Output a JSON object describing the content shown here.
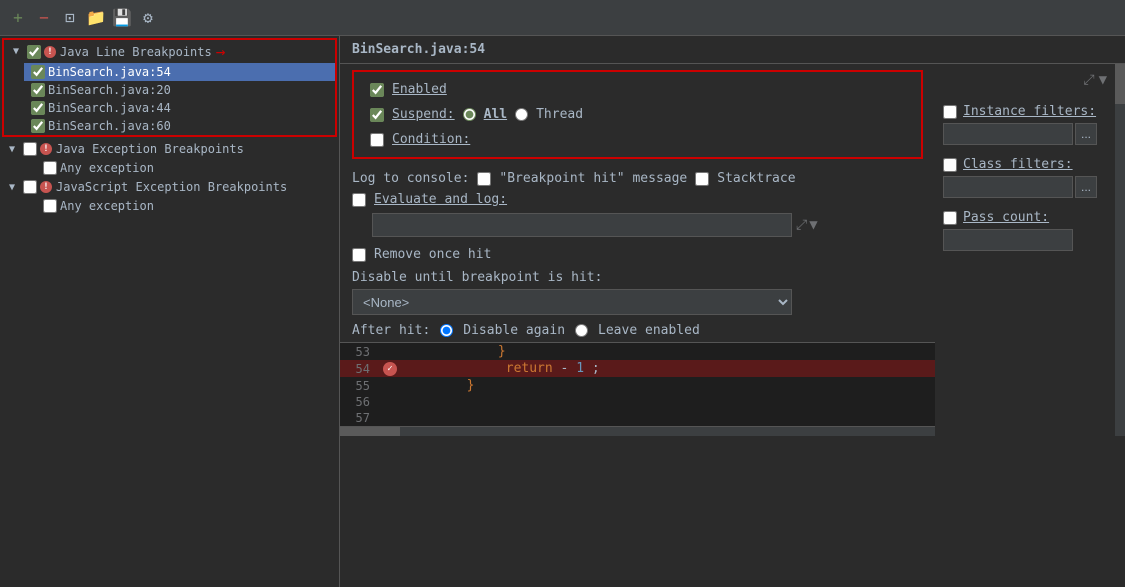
{
  "toolbar": {
    "add_label": "+",
    "remove_label": "−",
    "group_label": "⊡",
    "bookmark_label": "🔖",
    "settings_label": "⚙"
  },
  "left_panel": {
    "java_line_breakpoints": {
      "label": "Java Line Breakpoints",
      "expanded": true,
      "items": [
        {
          "label": "BinSearch.java:54",
          "checked": true,
          "selected": true
        },
        {
          "label": "BinSearch.java:20",
          "checked": true,
          "selected": false
        },
        {
          "label": "BinSearch.java:44",
          "checked": true,
          "selected": false
        },
        {
          "label": "BinSearch.java:60",
          "checked": true,
          "selected": false
        }
      ]
    },
    "java_exception_breakpoints": {
      "label": "Java Exception Breakpoints",
      "expanded": true,
      "items": [
        {
          "label": "Any exception",
          "checked": false
        }
      ]
    },
    "javascript_exception_breakpoints": {
      "label": "JavaScript Exception Breakpoints",
      "expanded": true,
      "items": [
        {
          "label": "Any exception",
          "checked": false
        }
      ]
    }
  },
  "right_panel": {
    "header": "BinSearch.java:54",
    "enabled_label": "Enabled",
    "suspend_label": "Suspend:",
    "suspend_all_label": "All",
    "suspend_thread_label": "Thread",
    "condition_label": "Condition:",
    "log_to_console_label": "Log to console:",
    "breakpoint_hit_label": "\"Breakpoint hit\" message",
    "stacktrace_label": "Stacktrace",
    "evaluate_and_log_label": "Evaluate and log:",
    "remove_once_hit_label": "Remove once hit",
    "disable_until_label": "Disable until breakpoint is hit:",
    "disable_select_value": "<None>",
    "after_hit_label": "After hit:",
    "disable_again_label": "Disable again",
    "leave_enabled_label": "Leave enabled",
    "instance_filters_label": "Instance filters:",
    "class_filters_label": "Class filters:",
    "pass_count_label": "Pass count:"
  },
  "code": {
    "lines": [
      {
        "number": "53",
        "content": "}",
        "highlight": false,
        "breakpoint": false,
        "indent": 12
      },
      {
        "number": "54",
        "content": "return -1;",
        "highlight": true,
        "breakpoint": true,
        "indent": 12
      },
      {
        "number": "55",
        "content": "}",
        "highlight": false,
        "breakpoint": false,
        "indent": 8
      },
      {
        "number": "56",
        "content": "",
        "highlight": false,
        "breakpoint": false,
        "indent": 0
      },
      {
        "number": "57",
        "content": "",
        "highlight": false,
        "breakpoint": false,
        "indent": 0
      }
    ]
  }
}
